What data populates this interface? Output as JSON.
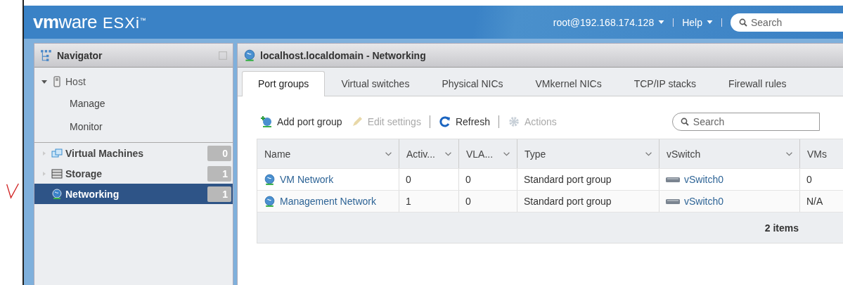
{
  "header": {
    "brand": "**vm**ware",
    "product": "ESXi$^{™}$",
    "user_menu": "root@192.168.174.128",
    "help_menu": "Help",
    "search": {
      "placeholder": "Search"
    }
  },
  "navigator": {
    "title": "Navigator",
    "items": [
      {
        "label": "Host",
        "kind": "host",
        "expanded": true,
        "selected": false,
        "children": [
          {
            "label": "Manage",
            "selected": false
          },
          {
            "label": "Monitor",
            "selected": false
          }
        ]
      },
      {
        "label": "Virtual Machines",
        "kind": "vms",
        "count": "0",
        "selected": false
      },
      {
        "label": "Storage",
        "kind": "storage",
        "count": "1",
        "selected": false
      },
      {
        "label": "Networking",
        "kind": "network",
        "count": "1",
        "selected": true
      }
    ]
  },
  "main": {
    "title": "localhost.localdomain - Networking",
    "tabs": [
      {
        "label": "Port groups",
        "selected": true
      },
      {
        "label": "Virtual switches",
        "selected": false
      },
      {
        "label": "Physical NICs",
        "selected": false
      },
      {
        "label": "VMkernel NICs",
        "selected": false
      },
      {
        "label": "TCP/IP stacks",
        "selected": false
      },
      {
        "label": "Firewall rules",
        "selected": false
      }
    ],
    "toolbar": [
      {
        "label": "Add port group",
        "kind": "add",
        "disabled": false
      },
      {
        "label": "Edit settings",
        "kind": "edit",
        "disabled": true
      },
      {
        "label": "Refresh",
        "kind": "refresh",
        "disabled": false
      },
      {
        "label": "Actions",
        "kind": "gear",
        "disabled": true
      }
    ],
    "search": {
      "placeholder": "Search"
    },
    "table": {
      "columns": [
        {
          "label": "Name",
          "sortable": true
        },
        {
          "label": "Activ...",
          "sortable": true
        },
        {
          "label": "VLA...",
          "sortable": true
        },
        {
          "label": "Type",
          "sortable": true
        },
        {
          "label": "vSwitch",
          "sortable": true
        },
        {
          "label": "VMs",
          "sortable": false
        }
      ],
      "rows": [
        {
          "name": "VM Network",
          "active": "0",
          "vlan": "0",
          "type": "Standard port group",
          "vswitch": "vSwitch0",
          "vms": "0"
        },
        {
          "name": "Management Network",
          "active": "1",
          "vlan": "0",
          "type": "Standard port group",
          "vswitch": "vSwitch0",
          "vms": "N/A"
        }
      ],
      "footer": "2 items"
    }
  }
}
